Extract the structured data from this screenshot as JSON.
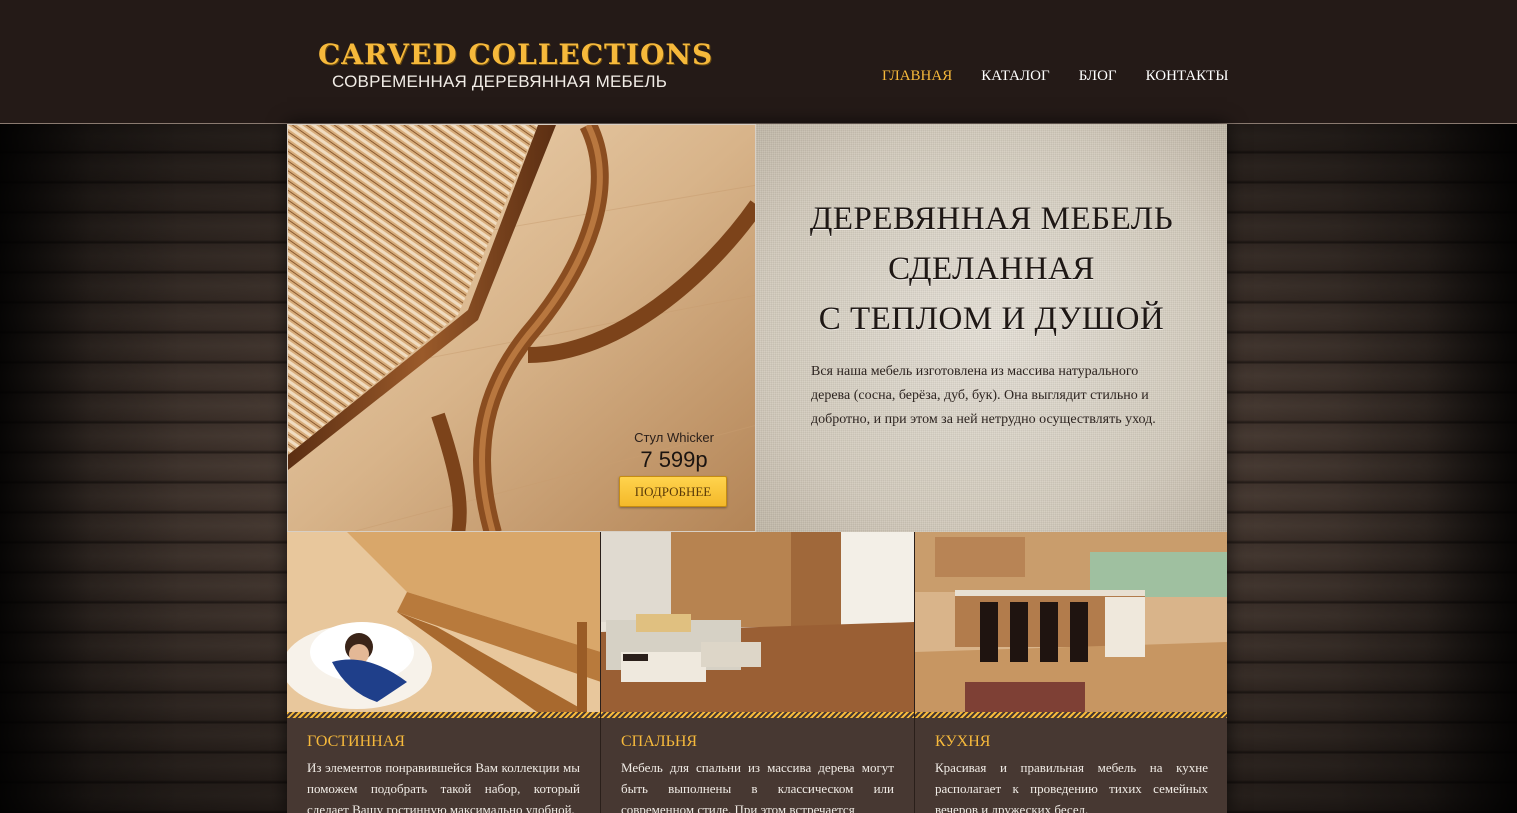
{
  "brand": {
    "title": "CARVED COLLECTIONS",
    "subtitle": "СОВРЕМЕННАЯ ДЕРЕВЯННАЯ МЕБЕЛЬ",
    "accent_color": "#f6b93b"
  },
  "nav": {
    "items": [
      {
        "label": "ГЛАВНАЯ",
        "active": true
      },
      {
        "label": "КАТАЛОГ",
        "active": false
      },
      {
        "label": "БЛОГ",
        "active": false
      },
      {
        "label": "КОНТАКТЫ",
        "active": false
      }
    ]
  },
  "hero": {
    "product_name": "Стул Whicker",
    "product_price": "7 599р",
    "product_button": "ПОДРОБНЕЕ",
    "heading_lines": [
      "ДЕРЕВЯННАЯ МЕБЕЛЬ",
      "СДЕЛАННАЯ",
      "С ТЕПЛОМ И ДУШОЙ"
    ],
    "description": "Вся наша мебель изготовлена из массива натурального дерева (сосна, берёза, дуб, бук). Она выглядит стильно и добротно, и при этом за ней нетрудно осуществлять уход."
  },
  "categories": [
    {
      "title": "ГОСТИННАЯ",
      "text": "Из элементов понравившейся Вам коллекции мы поможем подобрать такой набор, который сделает Вашу гостинную максимально удобной,"
    },
    {
      "title": "СПАЛЬНЯ",
      "text": "Мебель для спальни из массива дерева могут быть выполнены в классическом или современном стиле. При этом встречается"
    },
    {
      "title": "КУХНЯ",
      "text": "Красивая и правильная мебель на кухне располагает к проведению тихих семейных вечеров и дружеских бесед."
    }
  ]
}
